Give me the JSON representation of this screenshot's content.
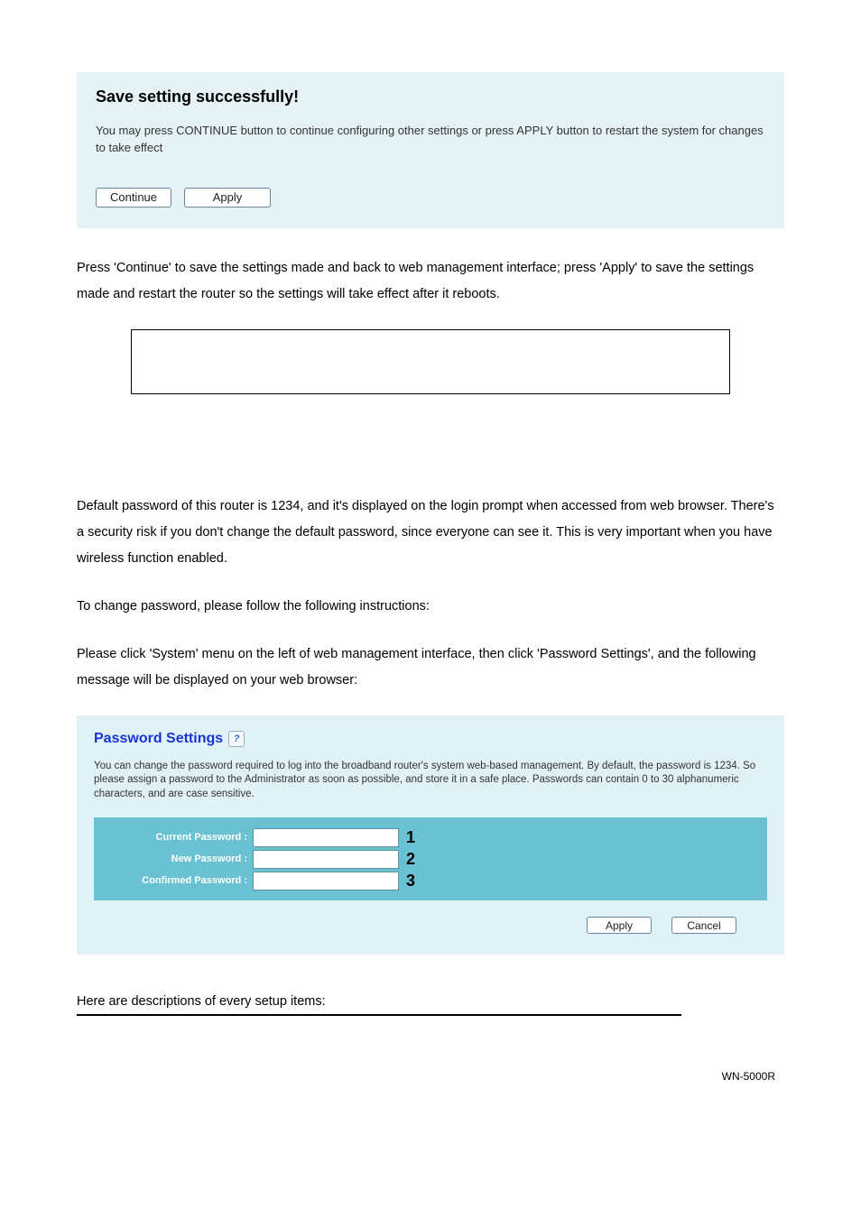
{
  "save_panel": {
    "title": "Save setting successfully!",
    "text": "You may press CONTINUE button to continue configuring other settings or press APPLY button to restart the system for changes to take effect",
    "continue_label": "Continue",
    "apply_label": "Apply"
  },
  "body": {
    "p1": "Press 'Continue' to save the settings made and back to web management interface; press 'Apply' to save the settings made and restart the router so the settings will take effect after it reboots.",
    "p2": "Default password of this router is 1234, and it's displayed on the login prompt when accessed from web browser. There's a security risk if you don't change the default password, since everyone can see it. This is very important when you have wireless function enabled.",
    "p3": "To change password, please follow the following instructions:",
    "p4": "Please click 'System' menu on the left of web management interface, then click 'Password Settings', and the following message will be displayed on your web browser:"
  },
  "password_panel": {
    "title": "Password Settings",
    "help_glyph": "?",
    "description": "You can change the password required to log into the broadband router's system web-based management. By default, the password is 1234. So please assign a password to the Administrator as soon as possible, and store it in a safe place. Passwords can contain 0 to 30 alphanumeric characters, and are case sensitive.",
    "rows": [
      {
        "label": "Current Password :",
        "callout": "1"
      },
      {
        "label": "New Password :",
        "callout": "2"
      },
      {
        "label": "Confirmed Password :",
        "callout": "3"
      }
    ],
    "apply_label": "Apply",
    "cancel_label": "Cancel"
  },
  "closing": "Here are descriptions of every setup items:",
  "footer": "WN-5000R"
}
